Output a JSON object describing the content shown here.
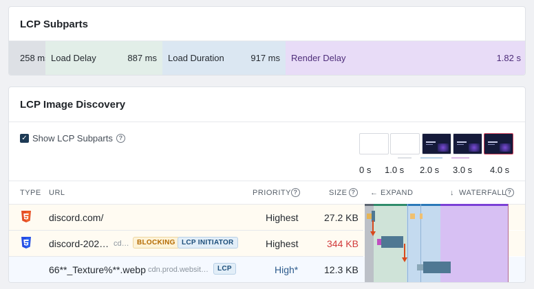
{
  "subparts": {
    "title": "LCP Subparts",
    "ttfb_value": "258 ms",
    "load_delay_label": "Load Delay",
    "load_delay_value": "887 ms",
    "load_duration_label": "Load Duration",
    "load_duration_value": "917 ms",
    "render_delay_label": "Render Delay",
    "render_delay_value": "1.82 s"
  },
  "discovery": {
    "title": "LCP Image Discovery",
    "show_subparts_label": "Show LCP Subparts",
    "show_subparts_checked": true,
    "help_glyph": "?",
    "filmstrip_times": [
      "0 s",
      "1.0 s",
      "2.0 s",
      "3.0 s",
      "4.0 s"
    ],
    "table": {
      "headers": {
        "type": "TYPE",
        "url": "URL",
        "priority": "PRIORITY",
        "size": "SIZE",
        "expand": "EXPAND",
        "waterfall": "WATERFALL"
      },
      "rows": [
        {
          "type_icon": "html5-icon",
          "url": "discord.com/",
          "domain": "",
          "badges": [],
          "priority": "Highest",
          "size": "27.2 KB"
        },
        {
          "type_icon": "css3-icon",
          "url": "discord-202…",
          "domain": "cd…",
          "badges": [
            "BLOCKING",
            "LCP INITIATOR"
          ],
          "priority": "Highest",
          "size": "344 KB"
        },
        {
          "type_icon": "",
          "url": "66**_Texture%**.webp",
          "domain": "cdn.prod.websit…",
          "badges": [
            "LCP"
          ],
          "priority": "High*",
          "size": "12.3 KB"
        }
      ]
    }
  },
  "colors": {
    "ttfb": "#dde0e5",
    "load_delay": "#e2eee8",
    "load_duration": "#dbe7f2",
    "render_delay": "#e8dcf7",
    "arrow": "#d9481b",
    "bar": "#4f7893"
  }
}
